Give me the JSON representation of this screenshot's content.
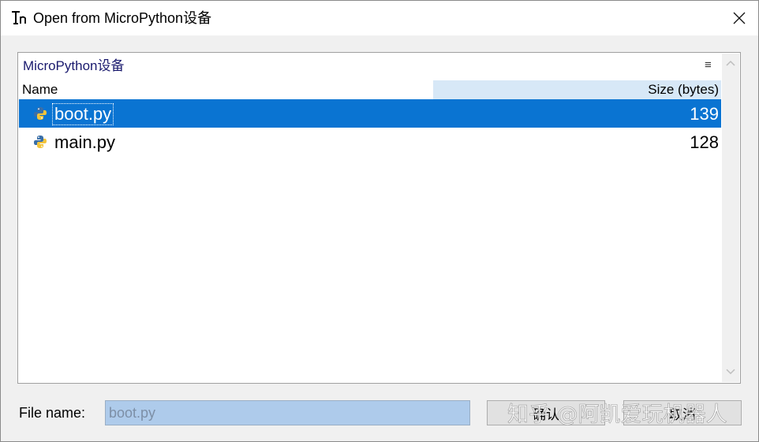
{
  "window": {
    "title": "Open from MicroPython设备",
    "app_icon": "thonny-logo-icon",
    "close_icon": "close-icon"
  },
  "browser": {
    "location": "MicroPython设备",
    "menu_icon": "hamburger-menu-icon",
    "columns": {
      "name": "Name",
      "size": "Size (bytes)"
    },
    "files": [
      {
        "name": "boot.py",
        "size": "139",
        "icon": "python-file-icon",
        "selected": true
      },
      {
        "name": "main.py",
        "size": "128",
        "icon": "python-file-icon",
        "selected": false
      }
    ]
  },
  "footer": {
    "file_name_label": "File name:",
    "file_name_value": "boot.py",
    "ok_label": "确认",
    "cancel_label": "取消"
  },
  "watermark": "知乎 @阿凯爱玩机器人",
  "colors": {
    "selection": "#0a74d2",
    "size_header": "#d7e8f7",
    "location_text": "#1a1a6e",
    "input_bg": "#aecbeb"
  }
}
